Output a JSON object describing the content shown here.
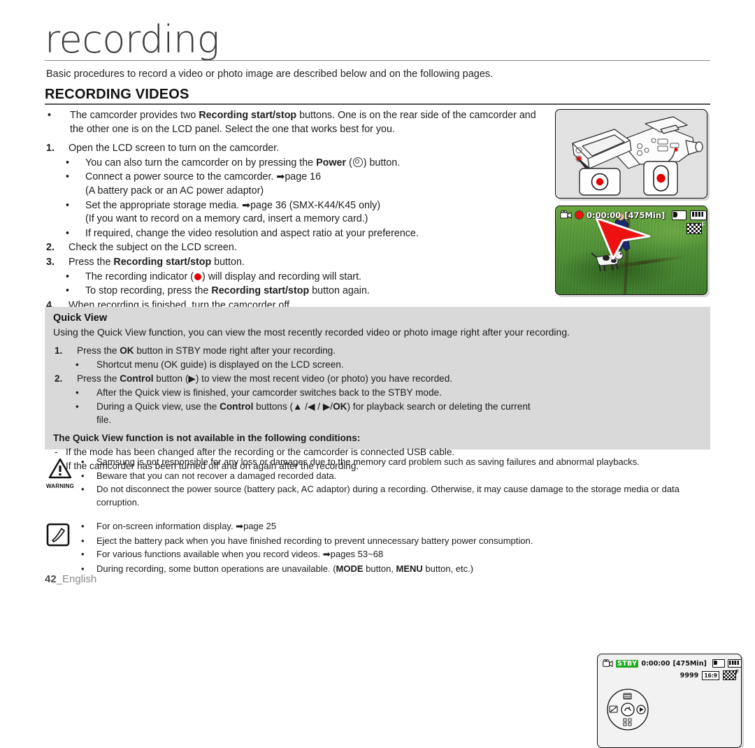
{
  "header": {
    "chapter_title": "recording",
    "intro": "Basic procedures to record a video or photo image are described below and on the following pages.",
    "section_title": "RECORDING VIDEOS"
  },
  "main": {
    "intro_bullet": {
      "line1_a": "The camcorder provides two ",
      "line1_b": "Recording start/stop",
      "line1_c": " buttons. One is on the rear side of the camcorder and the other one is on the LCD panel. Select the one that works best for you."
    },
    "steps": [
      {
        "num": "1.",
        "text": "Open the LCD screen to turn on the camcorder.",
        "subs": [
          {
            "pre": "You can also turn the camcorder on by pressing the ",
            "bold": "Power",
            "post": " (",
            "icon": "power-icon",
            "post2": ") button."
          },
          {
            "pre": "Connect a power source to the camcorder. ",
            "arrow": "➡",
            "post": "page 16",
            "second_line": "(A battery pack or an AC power adaptor)"
          },
          {
            "pre": "Set the appropriate storage media. ",
            "arrow": "➡",
            "post": "page 36 (SMX-K44/K45 only)",
            "second_line": "(If you want to record on a memory card, insert a memory card.)"
          },
          {
            "pre": "If required, change the video resolution and aspect ratio at your preference."
          }
        ]
      },
      {
        "num": "2.",
        "text": "Check the subject on the LCD screen.",
        "subs": []
      },
      {
        "num": "3.",
        "pre": "Press the ",
        "bold": "Recording start/stop",
        "post": " button.",
        "subs": [
          {
            "pre": "The recording indicator (",
            "icon": "record-dot-icon",
            "post": ") will display and recording will start."
          },
          {
            "pre": "To stop recording, press the ",
            "bold": "Recording start/stop",
            "post": " button again."
          }
        ]
      },
      {
        "num": "4.",
        "text": "When recording is finished, turn the camcorder off.",
        "subs": []
      }
    ]
  },
  "quick_view": {
    "title": "Quick View",
    "subtitle": "Using the Quick View function, you can view the most recently recorded video or photo image right after your recording.",
    "items": [
      {
        "num": "1.",
        "pre": "Press the ",
        "bold": "OK",
        "post": " button in STBY mode right after your recording.",
        "subs": [
          {
            "text": "Shortcut menu (OK guide) is displayed on the LCD screen."
          }
        ]
      },
      {
        "num": "2.",
        "pre": "Press the ",
        "bold": "Control",
        "post": " button (▶) to view the most recent video (or photo) you have recorded.",
        "subs": [
          {
            "text": "After the Quick view is finished, your camcorder switches back to the STBY mode."
          },
          {
            "pre": "During a Quick view, use the ",
            "bold": "Control",
            "mid": " buttons (▲ /◀ / ▶/",
            "bold2": "OK",
            "post": ") for playback search or deleting the current file."
          }
        ]
      }
    ],
    "conditions_title": "The Quick View function is not available in the following conditions:",
    "conditions": [
      "If the mode has been changed after the recording or the camcorder is connected USB cable.",
      "If the camcorder has been turned off and on again after the recording."
    ]
  },
  "warnings": {
    "icon_label": "WARNING",
    "items": [
      "Samsung is not responsible for any loss or damages due to the memory card problem such as saving failures and abnormal playbacks.",
      "Beware that you can not recover a damaged recorded data.",
      "Do not disconnect the power source (battery pack, AC adaptor) during a recording. Otherwise, it may cause damage to the storage media or data corruption."
    ]
  },
  "notes": {
    "items": [
      {
        "pre": "For on-screen information display. ",
        "arrow": "➡",
        "post": "page 25"
      },
      {
        "pre": "Eject the battery pack when you have finished recording to prevent unnecessary battery power consumption."
      },
      {
        "pre": "For various functions available when you record videos. ",
        "arrow": "➡",
        "post": "pages 53~68"
      },
      {
        "pre": "During recording, some button operations are unavailable. (",
        "bold": "MODE",
        "mid": " button, ",
        "bold2": "MENU",
        "post": " button, etc.)"
      }
    ]
  },
  "figures": {
    "camcorder": {
      "caption": "",
      "record_button_color": "#e60000"
    },
    "lcd_preview": {
      "timecode": "0:00:00",
      "remaining": "[475Min]",
      "quality_badge": "F"
    },
    "stby_screen": {
      "mode": "STBY",
      "timecode": "0:00:00",
      "remaining": "[475Min]",
      "photo_count": "9999",
      "resolution_chip": "16:9",
      "quality_badge": "F"
    }
  },
  "footer": {
    "page_number": "42",
    "language": "_English"
  },
  "colors": {
    "panel_gray": "#d9d9d9",
    "record_red": "#e60000",
    "stby_green": "#1faa1f",
    "rule_gray": "#8a8a8a"
  }
}
